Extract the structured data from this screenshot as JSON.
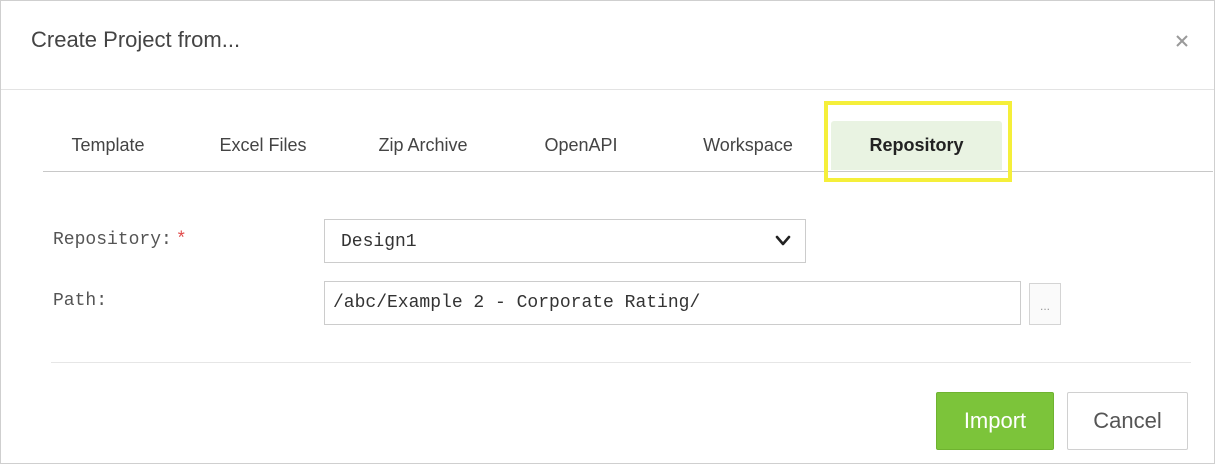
{
  "dialog": {
    "title": "Create Project from...",
    "close_label": "×"
  },
  "tabs": [
    {
      "label": "Template",
      "active": false
    },
    {
      "label": "Excel Files",
      "active": false
    },
    {
      "label": "Zip Archive",
      "active": false
    },
    {
      "label": "OpenAPI",
      "active": false
    },
    {
      "label": "Workspace",
      "active": false
    },
    {
      "label": "Repository",
      "active": true
    }
  ],
  "form": {
    "repository_label": "Repository:",
    "required_mark": "*",
    "repository_value": "Design1",
    "path_label": "Path:",
    "path_value": "/abc/Example 2 - Corporate Rating/",
    "browse_label": "..."
  },
  "actions": {
    "import_label": "Import",
    "cancel_label": "Cancel"
  },
  "colors": {
    "accent": "#7cc43a",
    "active_tab_bg": "#e9f3e2",
    "highlight": "#f5ef3a",
    "required": "#e04a4a"
  },
  "icons": {
    "close": "close-icon",
    "dropdown": "chevron-down-icon"
  }
}
